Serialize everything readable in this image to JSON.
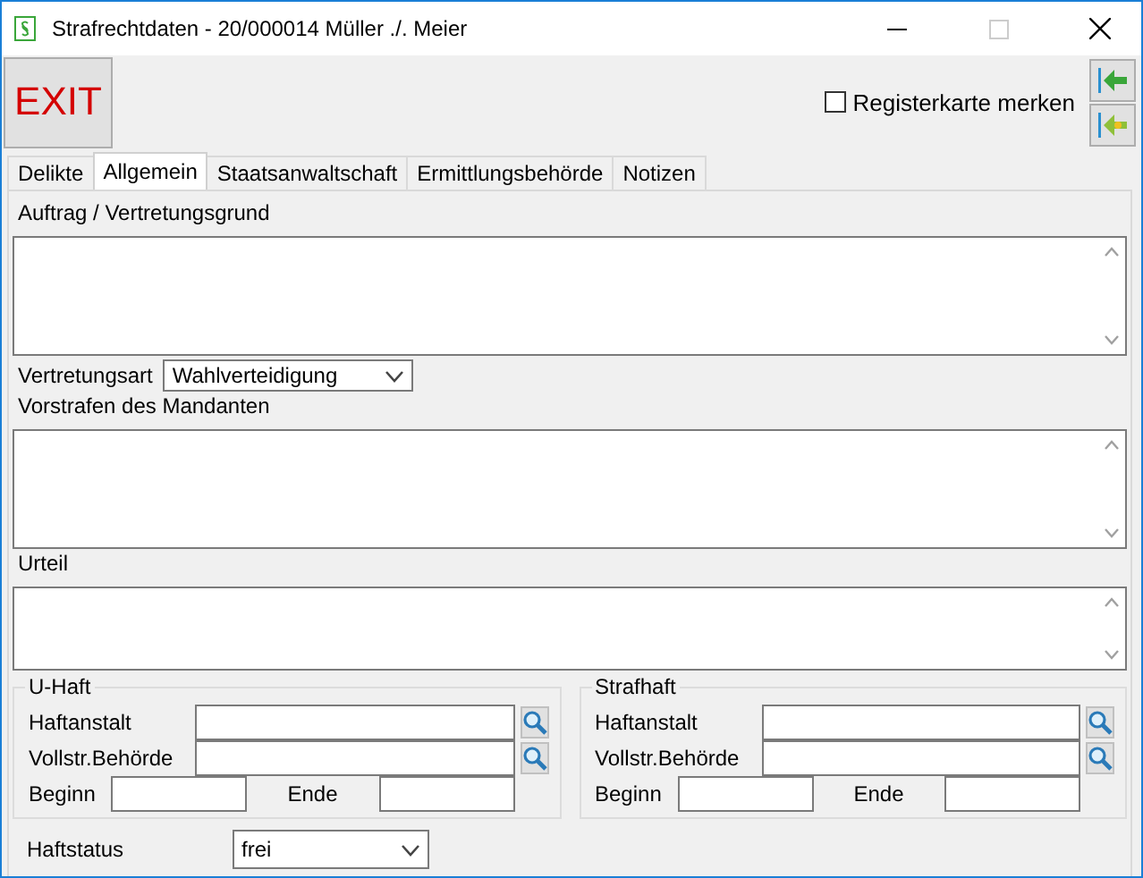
{
  "window": {
    "title": "Strafrechtdaten - 20/000014  Müller ./. Meier"
  },
  "toolbar": {
    "exit_button": "EXIT",
    "remember_tab": {
      "label": "Registerkarte merken",
      "checked": false
    }
  },
  "tabs": [
    {
      "label": "Delikte",
      "selected": false
    },
    {
      "label": "Allgemein",
      "selected": true
    },
    {
      "label": "Staatsanwaltschaft",
      "selected": false
    },
    {
      "label": "Ermittlungsbehörde",
      "selected": false
    },
    {
      "label": "Notizen",
      "selected": false
    }
  ],
  "fields": [
    {
      "kind": "textarea",
      "label": "Auftrag / Vertretungsgrund"
    },
    {
      "kind": "select",
      "label": "Vertretungsart",
      "value": "Wahlverteidigung"
    },
    {
      "kind": "textarea",
      "label": "Vorstrafen des Mandanten"
    },
    {
      "kind": "textarea",
      "label": "Urteil"
    }
  ],
  "custody_groups": [
    {
      "title": "U-Haft",
      "institution_label": "Haftanstalt",
      "authority_label": "Vollstr.Behörde",
      "begin_label": "Beginn",
      "end_label": "Ende"
    },
    {
      "title": "Strafhaft",
      "institution_label": "Haftanstalt",
      "authority_label": "Vollstr.Behörde",
      "begin_label": "Beginn",
      "end_label": "Ende"
    }
  ],
  "status": {
    "label": "Haftstatus",
    "value": "frei"
  }
}
